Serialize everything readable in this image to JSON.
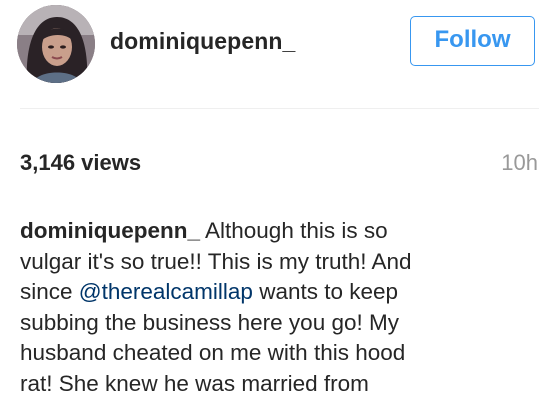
{
  "post": {
    "username": "dominiquepenn_",
    "follow_label": "Follow",
    "views": "3,146 views",
    "time_ago": "10h"
  },
  "caption": {
    "author": "dominiquepenn_",
    "line1_rest": " Although this is so",
    "line2": "vulgar it's so true!! This is my truth! And",
    "line3_before": "since ",
    "mention": "@therealcamillap",
    "line3_after": " wants to keep",
    "line4": "subbing the business here you go! My",
    "line5": "husband cheated on me with this hood",
    "line6": "rat! She knew he was married from"
  },
  "colors": {
    "link_blue": "#3897f0",
    "mention_blue": "#003569",
    "text_dark": "#262626",
    "text_muted": "#999999"
  }
}
